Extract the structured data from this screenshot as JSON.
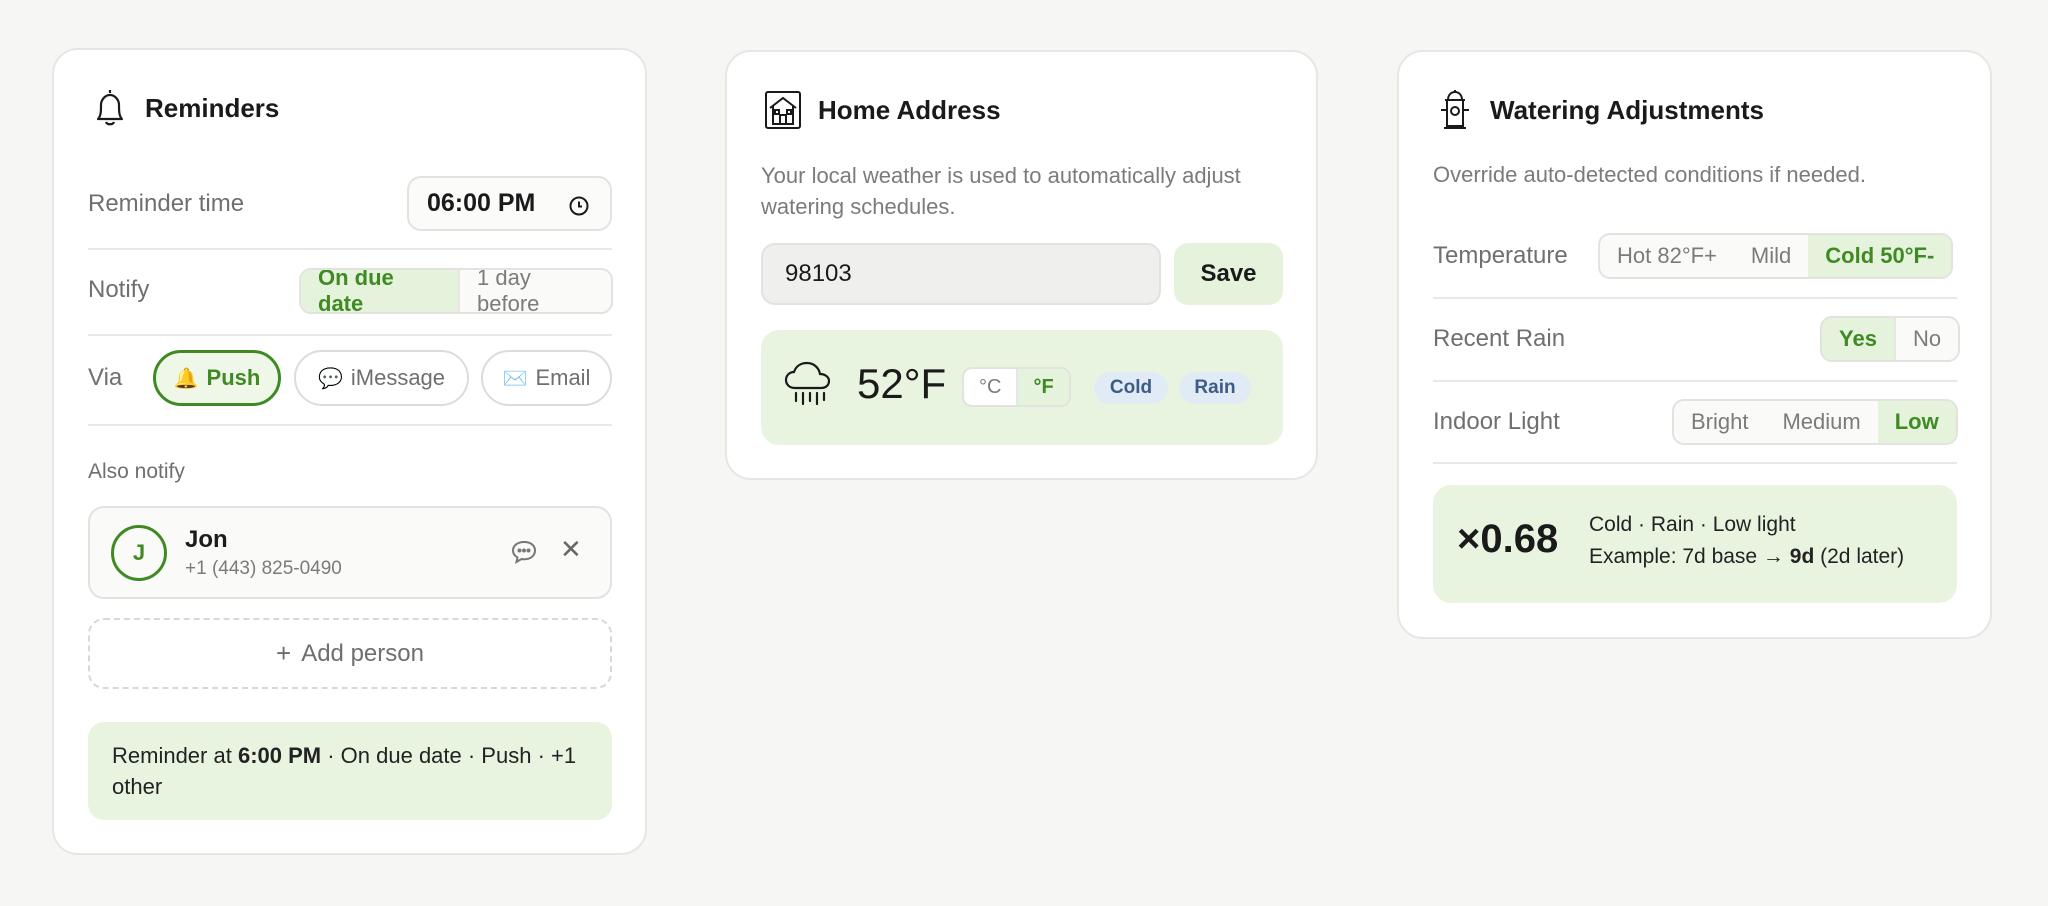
{
  "reminders": {
    "title": "Reminders",
    "reminder_time_label": "Reminder time",
    "reminder_time_value": "06:00 PM",
    "notify_label": "Notify",
    "notify_options": [
      "On due date",
      "1 day before"
    ],
    "notify_selected": "On due date",
    "via_label": "Via",
    "via_options": [
      {
        "icon": "bell",
        "label": "Push",
        "active": true
      },
      {
        "icon": "speech-bubble",
        "label": "iMessage",
        "active": false
      },
      {
        "icon": "envelope",
        "label": "Email",
        "active": false
      }
    ],
    "also_notify_label": "Also notify",
    "person": {
      "initial": "J",
      "name": "Jon",
      "phone": "+1 (443) 825-0490"
    },
    "add_person_label": "Add person",
    "summary": {
      "prefix": "Reminder at ",
      "time": "6:00 PM",
      "rest": " · On due date · Push · +1",
      "line2": "other"
    }
  },
  "home": {
    "title": "Home Address",
    "description_line1": "Your local weather is used to automatically adjust",
    "description_line2": "watering schedules.",
    "zip_value": "98103",
    "save_label": "Save",
    "weather": {
      "icon": "rain-cloud",
      "temperature": "52°F",
      "units": [
        "°C",
        "°F"
      ],
      "unit_selected": "°F",
      "tags": [
        "Cold",
        "Rain"
      ]
    }
  },
  "watering": {
    "title": "Watering Adjustments",
    "description": "Override auto-detected conditions if needed.",
    "temperature_label": "Temperature",
    "temperature_options": [
      "Hot 82°F+",
      "Mild",
      "Cold 50°F-"
    ],
    "temperature_selected": "Cold 50°F-",
    "rain_label": "Recent Rain",
    "rain_options": [
      "Yes",
      "No"
    ],
    "rain_selected": "Yes",
    "light_label": "Indoor Light",
    "light_options": [
      "Bright",
      "Medium",
      "Low"
    ],
    "light_selected": "Low",
    "multiplier": "×0.68",
    "conditions_line": "Cold · Rain · Low light",
    "example": {
      "prefix": "Example: 7d base → ",
      "result": "9d",
      "suffix": " (2d later)"
    }
  },
  "colors": {
    "accent_green": "#3f8a23",
    "light_green_bg": "#e8f4e0",
    "tag_blue": "#3d5c86"
  }
}
